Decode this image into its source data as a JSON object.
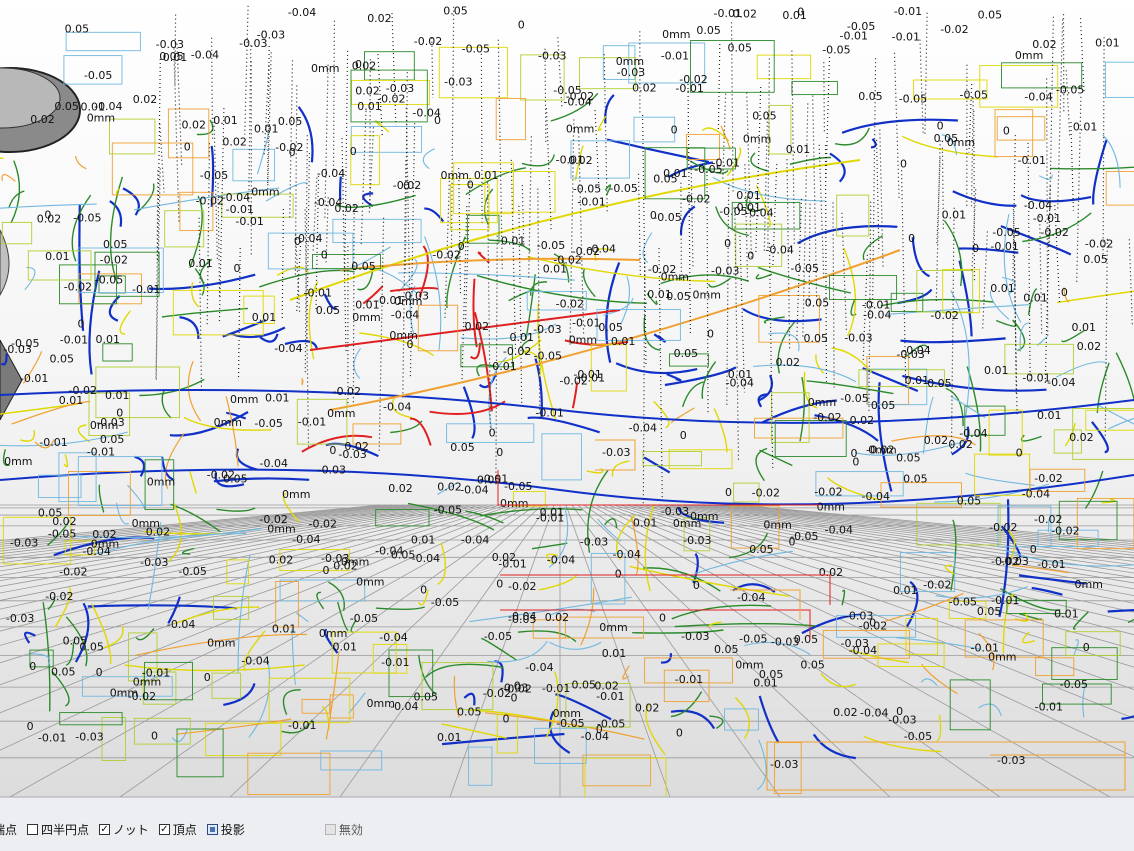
{
  "viewport": {
    "dimension_labels": [
      "0",
      "0mm",
      "-0.01",
      "-0.02",
      "-0.03",
      "-0.05",
      "0.01",
      "0.02",
      "-0.04",
      "0.05"
    ],
    "callouts": [
      {
        "text": "-0.03"
      },
      {
        "text": "-0.05"
      },
      {
        "text": "-0.02"
      },
      {
        "text": "-0.05"
      },
      {
        "text": "-0.04"
      },
      {
        "text": "-0.03"
      },
      {
        "text": "-0.03"
      },
      {
        "text": "0mm"
      }
    ],
    "colors": {
      "background_top": "#ffffff",
      "background_bottom": "#dcdcdc",
      "grid": "#9a9a9a",
      "blue_curves": "#1030c8",
      "green_curves": "#2a8a2a",
      "yellow_curves": "#e0d800",
      "orange_curves": "#f0a030",
      "red_curves": "#e02020",
      "lightblue_curves": "#70b8e0",
      "dim_boxes": "#b0d030"
    }
  },
  "statusbar": {
    "snaps": [
      {
        "name": "snap-endpoint",
        "label": "端点",
        "state": "partial"
      },
      {
        "name": "snap-quad",
        "label": "四半円点",
        "state": "unchecked"
      },
      {
        "name": "snap-knot",
        "label": "ノット",
        "state": "checked"
      },
      {
        "name": "snap-vertex",
        "label": "頂点",
        "state": "checked"
      },
      {
        "name": "snap-project",
        "label": "投影",
        "state": "filled"
      },
      {
        "name": "snap-disable",
        "label": "無効",
        "state": "disabled"
      }
    ]
  }
}
